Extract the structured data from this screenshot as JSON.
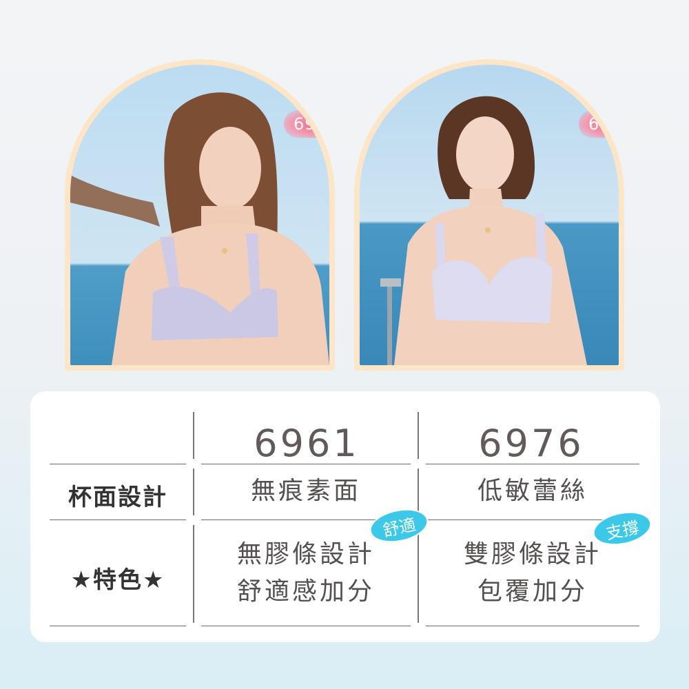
{
  "products": {
    "left": {
      "model": "6961"
    },
    "right": {
      "model": "6976"
    }
  },
  "table": {
    "columns": [
      "6961",
      "6976"
    ],
    "rows": [
      {
        "label": "杯面設計",
        "values": [
          "無痕素面",
          "低敏蕾絲"
        ]
      },
      {
        "label": "★特色★",
        "values": [
          [
            "無膠條設計",
            "舒適感加分"
          ],
          [
            "雙膠條設計",
            "包覆加分"
          ]
        ]
      }
    ],
    "badges": [
      "舒適",
      "支撐"
    ]
  },
  "colors": {
    "arch_frame": "#fde6c8",
    "tag_pink": "#f06a86",
    "badge_blue": "#3cc8e8",
    "text": "#555050"
  }
}
